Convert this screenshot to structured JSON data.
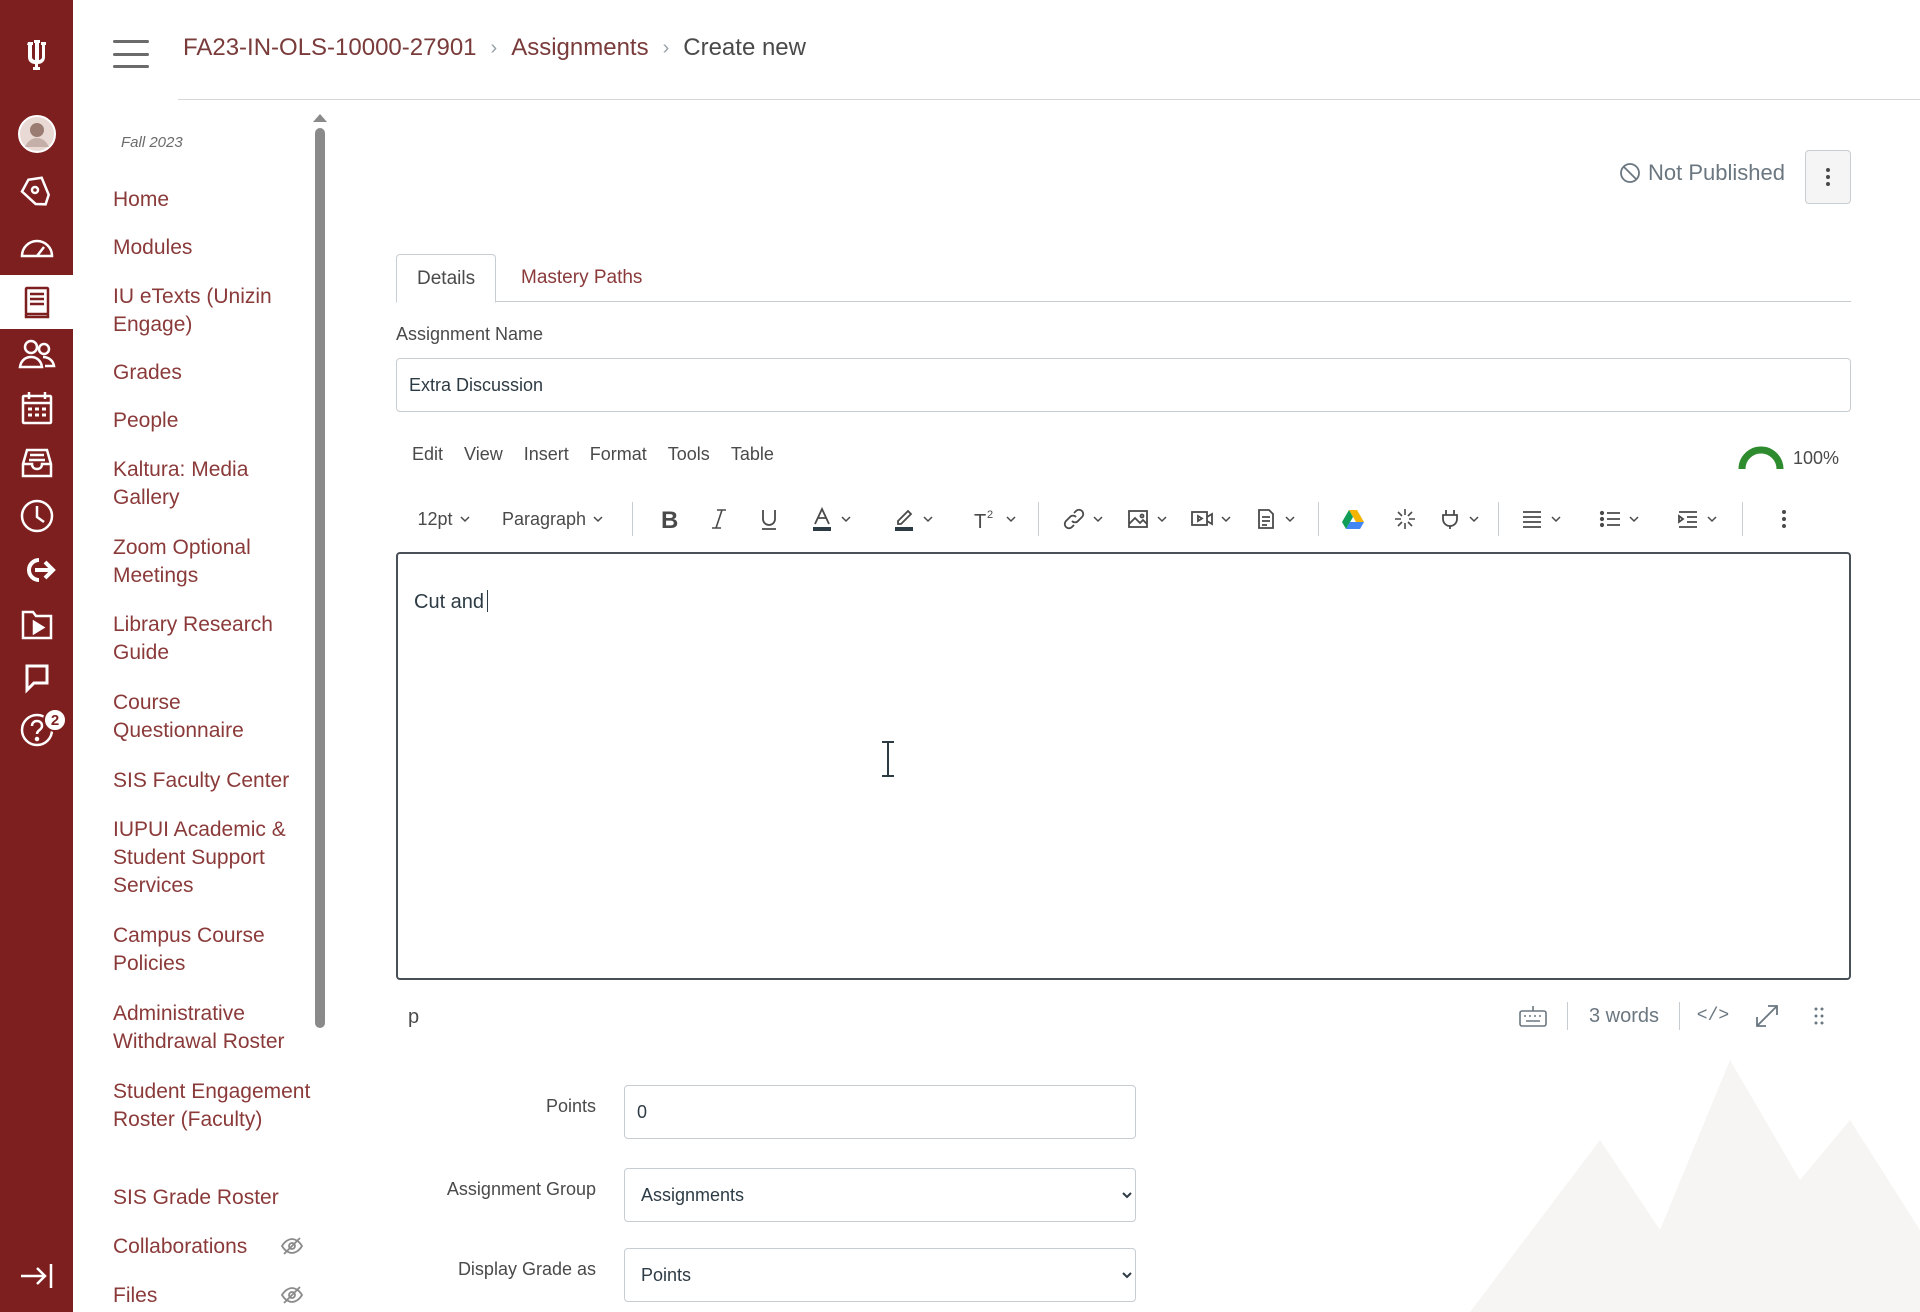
{
  "global_nav": {
    "items": [
      {
        "name": "iu-logo",
        "icon": "iu-trident-icon"
      },
      {
        "name": "account",
        "icon": "avatar"
      },
      {
        "name": "admin",
        "icon": "shield-icon"
      },
      {
        "name": "dashboard",
        "icon": "dashboard-icon"
      },
      {
        "name": "courses",
        "icon": "courses-icon",
        "active": true
      },
      {
        "name": "groups",
        "icon": "groups-icon"
      },
      {
        "name": "calendar",
        "icon": "calendar-icon"
      },
      {
        "name": "inbox",
        "icon": "inbox-icon"
      },
      {
        "name": "history",
        "icon": "clock-icon"
      },
      {
        "name": "commons",
        "icon": "commons-icon"
      },
      {
        "name": "studio",
        "icon": "studio-icon"
      },
      {
        "name": "feedback",
        "icon": "feedback-icon"
      },
      {
        "name": "help",
        "icon": "help-icon",
        "badge": "2"
      },
      {
        "name": "collapse",
        "icon": "collapse-nav-icon"
      }
    ],
    "help_badge": "2",
    "accent_color": "#7d1f1f"
  },
  "header": {
    "breadcrumb": {
      "course": "FA23-IN-OLS-10000-27901",
      "section": "Assignments",
      "current": "Create new"
    }
  },
  "course_nav": {
    "term": "Fall 2023",
    "items": [
      {
        "label": "Home"
      },
      {
        "label": "Modules"
      },
      {
        "label": "IU eTexts (Unizin Engage)"
      },
      {
        "label": "Grades"
      },
      {
        "label": "People"
      },
      {
        "label": "Kaltura: Media Gallery"
      },
      {
        "label": "Zoom Optional Meetings"
      },
      {
        "label": "Library Research Guide"
      },
      {
        "label": "Course Questionnaire"
      },
      {
        "label": "SIS Faculty Center"
      },
      {
        "label": "IUPUI Academic & Student Support Services"
      },
      {
        "label": "Campus Course Policies"
      },
      {
        "label": "Administrative Withdrawal Roster"
      },
      {
        "label": "Student Engagement Roster (Faculty)"
      },
      {
        "label": "SIS Grade Roster"
      },
      {
        "label": "Collaborations",
        "hidden_icon": "eye-slash-icon"
      },
      {
        "label": "Files",
        "hidden_icon": "eye-slash-icon"
      }
    ]
  },
  "main": {
    "publish_status": "Not Published",
    "tabs": [
      {
        "label": "Details",
        "active": true
      },
      {
        "label": "Mastery Paths",
        "active": false
      }
    ],
    "assignment_name_label": "Assignment Name",
    "assignment_name_value": "Extra Discussion"
  },
  "rce": {
    "menubar": [
      "Edit",
      "View",
      "Insert",
      "Format",
      "Tools",
      "Table"
    ],
    "accessibility_score": "100%",
    "font_size": "12pt",
    "block_format": "Paragraph",
    "toolbar_icons": [
      "bold-icon",
      "italic-icon",
      "underline-icon",
      "text-color-icon",
      "highlight-icon",
      "superscript-icon",
      "link-icon",
      "image-icon",
      "media-icon",
      "document-icon",
      "google-drive-icon",
      "apps-icon",
      "plugin-icon",
      "align-icon",
      "list-icon",
      "indent-icon",
      "more-icon"
    ],
    "content": "Cut and",
    "status_path": "p",
    "word_count": "3 words",
    "html_toggle": "</>"
  },
  "form": {
    "points_label": "Points",
    "points_value": "0",
    "group_label": "Assignment Group",
    "group_value": "Assignments",
    "display_label": "Display Grade as",
    "display_value": "Points"
  }
}
